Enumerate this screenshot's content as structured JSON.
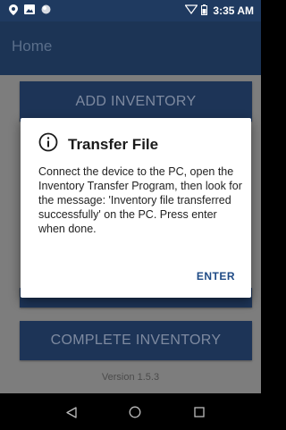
{
  "status_bar": {
    "time": "3:35 AM",
    "icons": [
      "location-pin-icon",
      "image-icon",
      "circle-icon",
      "wifi-icon",
      "battery-icon"
    ]
  },
  "app_bar": {
    "title": "Home"
  },
  "main": {
    "add_inventory_label": "ADD INVENTORY",
    "complete_inventory_label": "COMPLETE INVENTORY",
    "version": "Version 1.5.3"
  },
  "dialog": {
    "icon": "info-icon",
    "title": "Transfer File",
    "message": "Connect the device to the PC, open the Inventory Transfer Program, then look for the message: 'Inventory file transferred successfully' on the PC. Press enter when done.",
    "enter_label": "ENTER"
  },
  "nav_bar": {
    "icons": [
      "back-icon",
      "home-icon",
      "recents-icon"
    ]
  },
  "colors": {
    "status_bar": "#1f3a60",
    "app_bar": "#1c3455",
    "button": "#1d3457",
    "scrim": "#7d7d7d",
    "accent": "#1e4a85"
  }
}
